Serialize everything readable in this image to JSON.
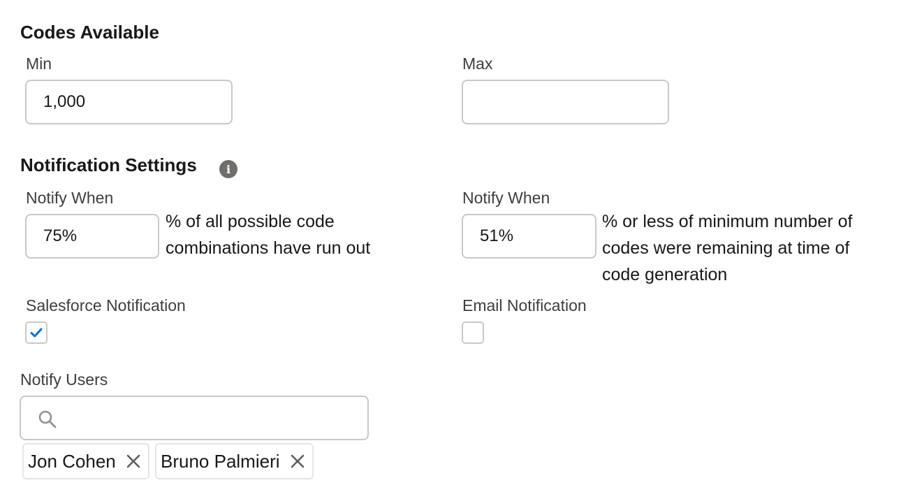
{
  "codes_available": {
    "title": "Codes Available",
    "min": {
      "label": "Min",
      "value": "1,000"
    },
    "max": {
      "label": "Max",
      "value": ""
    }
  },
  "notification_settings": {
    "title": "Notification Settings",
    "info_icon": "info-icon",
    "notify_when_left": {
      "label": "Notify When",
      "value": "75%",
      "description_line1": "% of all possible code",
      "description_line2": "combinations have run out"
    },
    "notify_when_right": {
      "label": "Notify When",
      "value": "51%",
      "description_line1": "% or less of minimum number of",
      "description_line2": "codes were remaining at time of",
      "description_line3": "code generation"
    },
    "salesforce_notification": {
      "label": "Salesforce Notification",
      "checked": true
    },
    "email_notification": {
      "label": "Email Notification",
      "checked": false
    }
  },
  "notify_users": {
    "label": "Notify Users",
    "search_value": "",
    "search_icon": "search-icon",
    "selected_users": [
      "Jon Cohen",
      "Bruno Palmieri"
    ]
  },
  "colors": {
    "border": "#c9c9c9",
    "checkmark": "#0176d3",
    "icon_gray": "#706e6b"
  }
}
